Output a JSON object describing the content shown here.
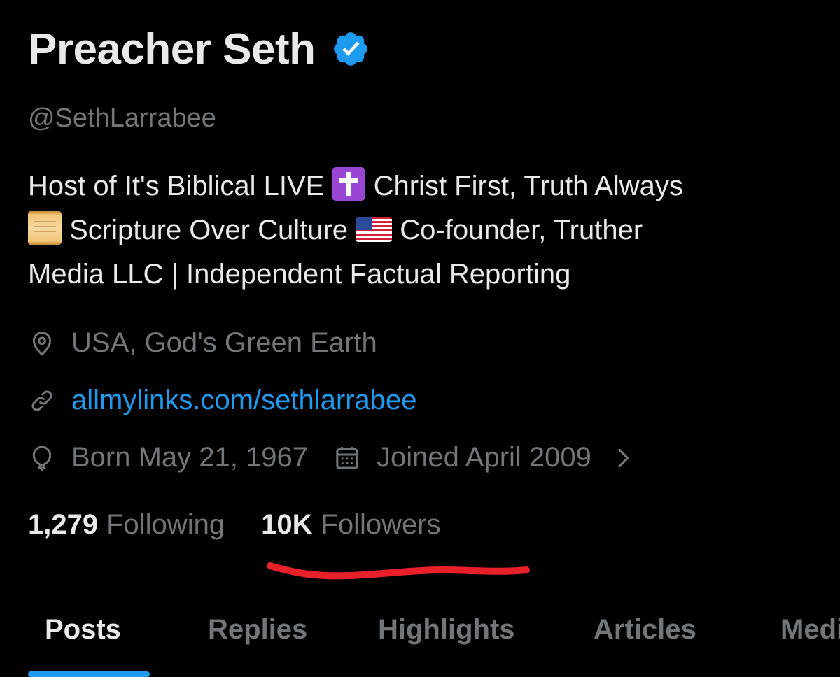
{
  "profile": {
    "display_name": "Preacher Seth",
    "handle": "@SethLarrabee",
    "bio": {
      "line1_a": "Host of It's Biblical LIVE",
      "line1_b": "Christ First, Truth Always",
      "line2_a": "Scripture Over Culture",
      "line2_b": "Co-founder, Truther",
      "line3": "Media LLC | Independent Factual Reporting",
      "emojis": [
        "cross-emoji",
        "scroll-emoji",
        "us-flag-emoji"
      ]
    },
    "location": "USA, God's Green Earth",
    "website": "allmylinks.com/sethlarrabee",
    "born": "Born May 21, 1967",
    "joined": "Joined April 2009",
    "stats": {
      "following_count": "1,279",
      "following_label": "Following",
      "followers_count": "10K",
      "followers_label": "Followers"
    }
  },
  "tabs": [
    {
      "label": "Posts",
      "active": true
    },
    {
      "label": "Replies",
      "active": false
    },
    {
      "label": "Highlights",
      "active": false
    },
    {
      "label": "Articles",
      "active": false
    },
    {
      "label": "Media",
      "active": false
    }
  ],
  "colors": {
    "background": "#000000",
    "primary_text": "#e7e9ea",
    "secondary_text": "#71767b",
    "link": "#1d9bf0",
    "verified_badge": "#1d9bf0",
    "tab_indicator": "#1d9bf0",
    "annotation_underline": "#e8202a"
  },
  "icons": {
    "verified": "verified-badge-icon",
    "location": "location-pin-icon",
    "link": "link-icon",
    "birthday": "balloon-icon",
    "joined": "calendar-icon",
    "chevron": "chevron-right-icon"
  }
}
